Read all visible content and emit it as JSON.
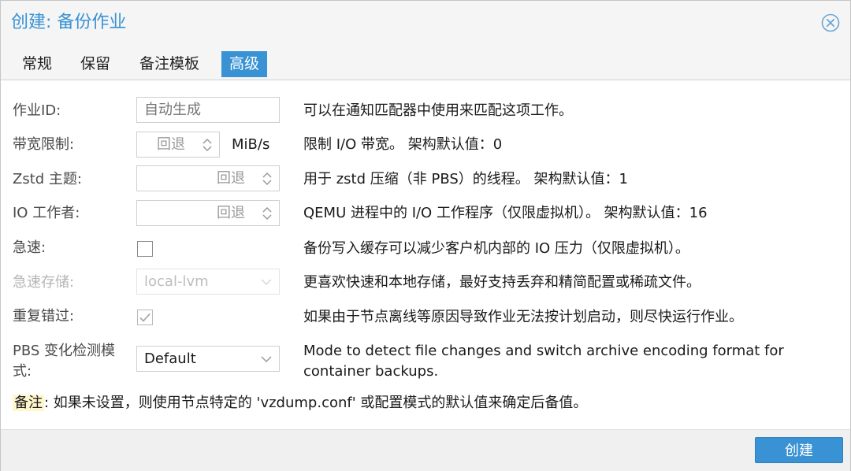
{
  "dialog": {
    "title": "创建: 备份作业",
    "close_icon": "close-circle-icon",
    "accent": "#3892d4"
  },
  "tabs": [
    {
      "label": "常规",
      "active": false
    },
    {
      "label": "保留",
      "active": false
    },
    {
      "label": "备注模板",
      "active": false
    },
    {
      "label": "高级",
      "active": true
    }
  ],
  "form": {
    "job_id": {
      "label": "作业ID:",
      "placeholder": "自动生成",
      "description": "可以在通知匹配器中使用来匹配这项工作。"
    },
    "bandwidth": {
      "label": "带宽限制:",
      "value": "回退",
      "unit": "MiB/s",
      "description": "限制 I/O 带宽。 架构默认值：0"
    },
    "zstd": {
      "label": "Zstd 主题:",
      "value": "回退",
      "description": "用于 zstd 压缩（非 PBS）的线程。 架构默认值：1"
    },
    "io_workers": {
      "label": "IO 工作者:",
      "value": "回退",
      "description": "QEMU 进程中的 I/O 工作程序（仅限虚拟机）。 架构默认值：16"
    },
    "fleecing": {
      "label": "急速:",
      "checked": false,
      "description": "备份写入缓存可以减少客户机内部的 IO 压力（仅限虚拟机）。"
    },
    "fleecing_storage": {
      "label": "急速存储:",
      "value": "local-lvm",
      "disabled": true,
      "description": "更喜欢快速和本地存储，最好支持丢弃和精简配置或稀疏文件。"
    },
    "repeat_missed": {
      "label": "重复错过:",
      "checked": true,
      "description": "如果由于节点离线等原因导致作业无法按计划启动，则尽快运行作业。"
    },
    "pbs_change_detection": {
      "label": "PBS 变化检测模式:",
      "value": "Default",
      "description": "Mode to detect file changes and switch archive encoding format for container backups."
    }
  },
  "note": {
    "prefix": "备注",
    "text": ": 如果未设置，则使用节点特定的 'vzdump.conf' 或配置模式的默认值来确定后备值。"
  },
  "footer": {
    "create_label": "创建"
  }
}
